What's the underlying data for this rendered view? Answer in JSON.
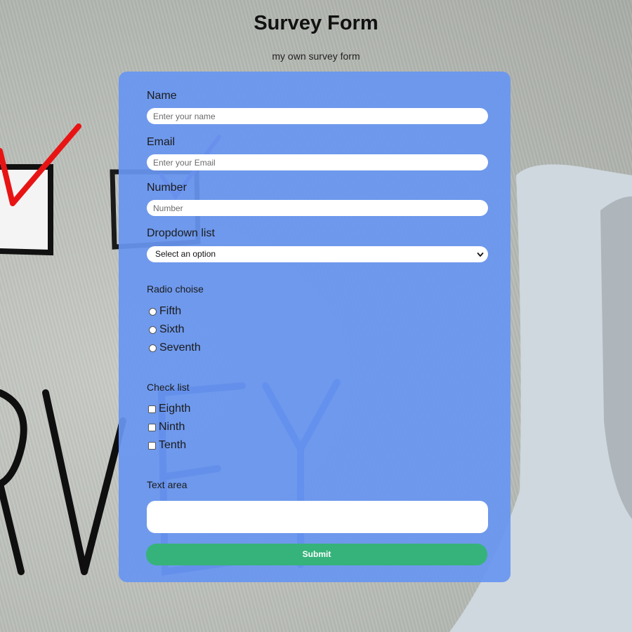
{
  "page": {
    "title": "Survey Form",
    "subtitle": "my own survey form"
  },
  "form": {
    "name": {
      "label": "Name",
      "placeholder": "Enter your name"
    },
    "email": {
      "label": "Email",
      "placeholder": "Enter your Email"
    },
    "number": {
      "label": "Number",
      "placeholder": "Number"
    },
    "dropdown": {
      "label": "Dropdown list",
      "selected": "Select an option"
    },
    "radio": {
      "label": "Radio choise",
      "options": [
        "Fifth",
        "Sixth",
        "Seventh"
      ]
    },
    "checklist": {
      "label": "Check list",
      "options": [
        "Eighth",
        "Ninth",
        "Tenth"
      ]
    },
    "textarea": {
      "label": "Text area"
    },
    "submit_label": "Submit"
  },
  "colors": {
    "card": "#6896f0",
    "submit": "#36b37a"
  }
}
